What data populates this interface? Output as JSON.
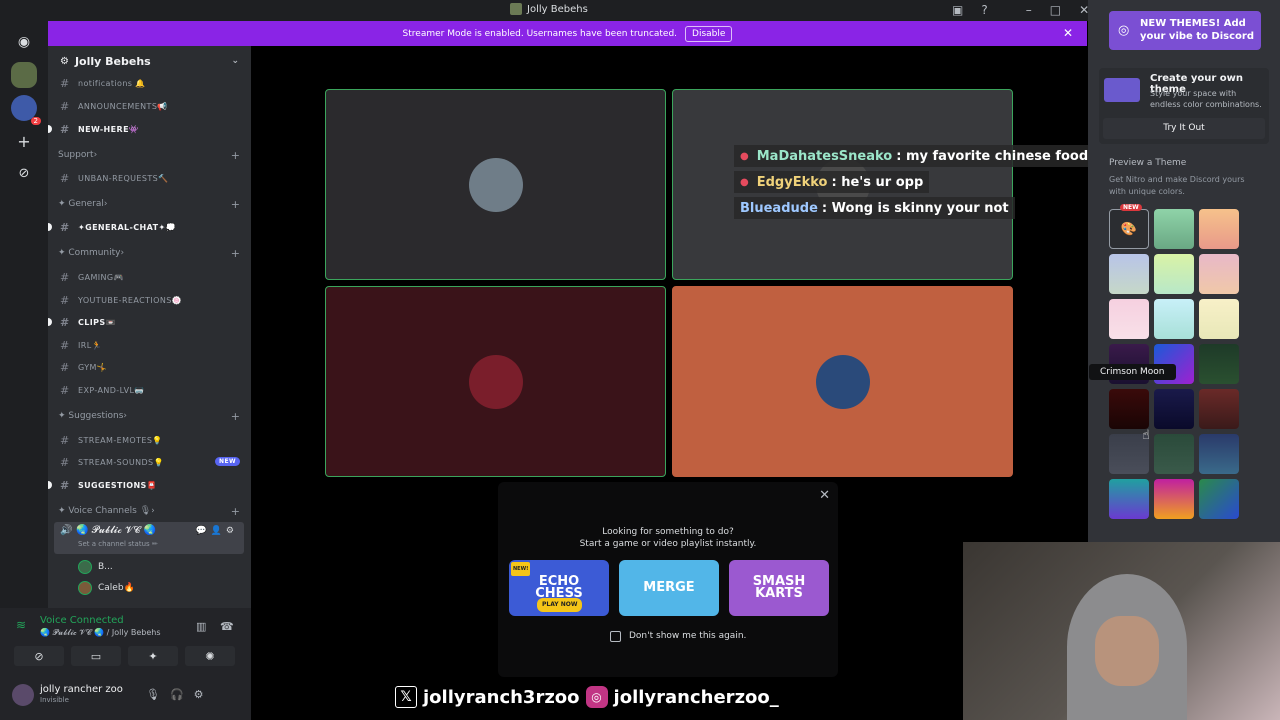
{
  "window": {
    "title": "Jolly Bebehs"
  },
  "banner": {
    "message": "Streamer Mode is enabled. Usernames have been truncated.",
    "disable_label": "Disable",
    "color": "#8a24e6"
  },
  "server": {
    "name": "Jolly Bebehs"
  },
  "rail": {
    "badge_count": "2"
  },
  "sidebar": {
    "items": [
      {
        "type": "channel",
        "label": "notifications 🔔",
        "unread": false
      },
      {
        "type": "channel",
        "label": "ANNOUNCEMENTS📢",
        "unread": false
      },
      {
        "type": "channel",
        "label": "NEW-HERE👾",
        "unread": true
      },
      {
        "type": "category",
        "label": "Support"
      },
      {
        "type": "channel",
        "label": "UNBAN-REQUESTS🔨",
        "unread": false
      },
      {
        "type": "category",
        "label": "✦ General"
      },
      {
        "type": "channel",
        "label": "✦GENERAL-CHAT✦💭",
        "unread": true
      },
      {
        "type": "category",
        "label": "✦ Community"
      },
      {
        "type": "channel",
        "label": "GAMING🎮",
        "unread": false
      },
      {
        "type": "channel",
        "label": "YOUTUBE-REACTIONS🍥",
        "unread": false
      },
      {
        "type": "channel",
        "label": "CLIPS📼",
        "unread": true
      },
      {
        "type": "channel",
        "label": "IRL🏃",
        "unread": false
      },
      {
        "type": "channel",
        "label": "GYM🤸",
        "unread": false
      },
      {
        "type": "channel",
        "label": "EXP-AND-LVL🥽",
        "unread": false
      },
      {
        "type": "category",
        "label": "✦ Suggestions"
      },
      {
        "type": "channel",
        "label": "STREAM-EMOTES💡",
        "unread": false
      },
      {
        "type": "channel",
        "label": "STREAM-SOUNDS💡",
        "unread": false,
        "badge": "NEW"
      },
      {
        "type": "channel",
        "label": "SUGGESTIONS📮",
        "unread": true
      },
      {
        "type": "category",
        "label": "✦ Voice Channels 🎙"
      }
    ],
    "voice_channel": {
      "name": "🌏 𝓟𝓾𝓫𝓵𝓲𝓬 𝓥𝓒 🌏",
      "status_placeholder": "Set a channel status ✏"
    },
    "members": [
      "B...",
      "Caleb🔥"
    ]
  },
  "voice_panel": {
    "status": "Voice Connected",
    "location": "🌏 𝓟𝓾𝓫𝓵𝓲𝓬 𝓥𝓒 🌏 / Jolly Bebehs",
    "user_name": "jolly rancher zoo",
    "user_status": "Invisible"
  },
  "chat_overlay": [
    {
      "user": "MaDahatesSneako",
      "message": ": my favorite chinese food is the cream of sum yung gai",
      "user_color": "#9be6c9",
      "bullet": true
    },
    {
      "user": "EdgyEkko",
      "message": ": he's ur opp",
      "user_color": "#f0d27a",
      "bullet": true
    },
    {
      "user": "Blueadude",
      "message": ": Wong is skinny your not",
      "user_color": "#9ec8ff",
      "bullet": false
    }
  ],
  "activity_popup": {
    "line1": "Looking for something to do?",
    "line2": "Start a game or video playlist instantly.",
    "games": [
      {
        "title": "ECHO\nCHESS",
        "cta": "PLAY NOW",
        "badge": "NEW!",
        "color": "#3c5bd6"
      },
      {
        "title": "MERGE",
        "color": "#52b6e8"
      },
      {
        "title": "SMASH\nKARTS",
        "color": "#9b59d0"
      }
    ],
    "checkbox_label": "Don't show me this again."
  },
  "theme_panel": {
    "promo": "NEW THEMES! Add your vibe to Discord",
    "create_title": "Create your own theme",
    "create_desc": "Style your space with endless color combinations.",
    "try_button": "Try It Out",
    "preview_label": "Preview a Theme",
    "nitro_text": "Get Nitro and make Discord yours with unique colors.",
    "nitro_word": "Nitro",
    "new_badge": "NEW",
    "tooltip": "Crimson Moon"
  },
  "socials": {
    "twitter": "jollyranch3rzoo",
    "instagram": "jollyrancherzoo_"
  }
}
